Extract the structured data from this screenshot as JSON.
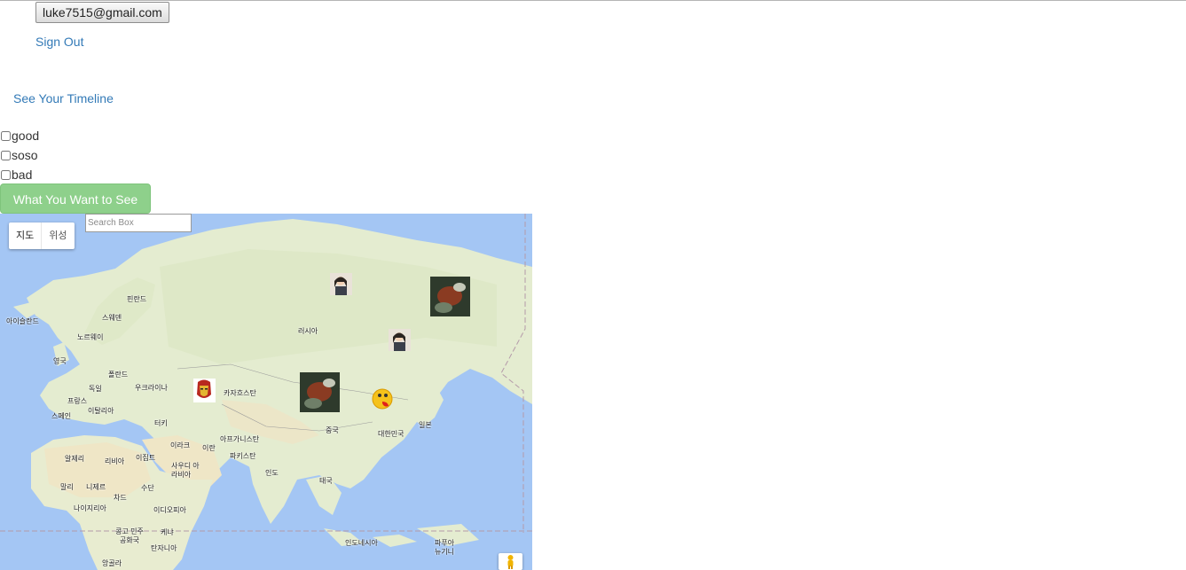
{
  "header": {
    "email_label": "luke7515@gmail.com",
    "sign_out_label": "Sign Out",
    "timeline_label": "See Your Timeline"
  },
  "filters": [
    {
      "label": "good",
      "checked": false
    },
    {
      "label": "soso",
      "checked": false
    },
    {
      "label": "bad",
      "checked": false
    }
  ],
  "submit_label": "What You Want to See",
  "map": {
    "type_controls": {
      "map": "지도",
      "satellite": "위성"
    },
    "search_placeholder": "Search Box",
    "labels": {
      "finland": "핀란드",
      "sweden": "스웨덴",
      "norway": "노르웨이",
      "iceland": "아이슬란드",
      "uk": "영국",
      "poland": "폴란드",
      "germany": "독일",
      "ukraine": "우크라이나",
      "france": "프랑스",
      "italy": "이탈리아",
      "spain": "스페인",
      "russia": "러시아",
      "kazakhstan": "카자흐스탄",
      "turkey": "터키",
      "iraq": "이라크",
      "iran": "이란",
      "afghanistan": "아프가니스탄",
      "pakistan": "파키스탄",
      "china": "중국",
      "korea": "대한민국",
      "japan": "일본",
      "india": "인도",
      "thailand": "태국",
      "saudi": "사우디 아라비아",
      "algeria": "알제리",
      "libya": "리비아",
      "egypt": "이집트",
      "mali": "말리",
      "niger": "니제르",
      "chad": "차드",
      "sudan": "수단",
      "nigeria": "나이지리아",
      "ethiopia": "이디오피아",
      "drc": "콩고 민주 공화국",
      "kenya": "케냐",
      "tanzania": "탄자니아",
      "angola": "앙골라",
      "indonesia": "인도네시아",
      "png": "파푸아 뉴기니"
    }
  },
  "colors": {
    "link": "#337ab7",
    "button_bg": "#8ed08b",
    "ocean": "#a4c6f4",
    "land": "#e8eed4"
  }
}
